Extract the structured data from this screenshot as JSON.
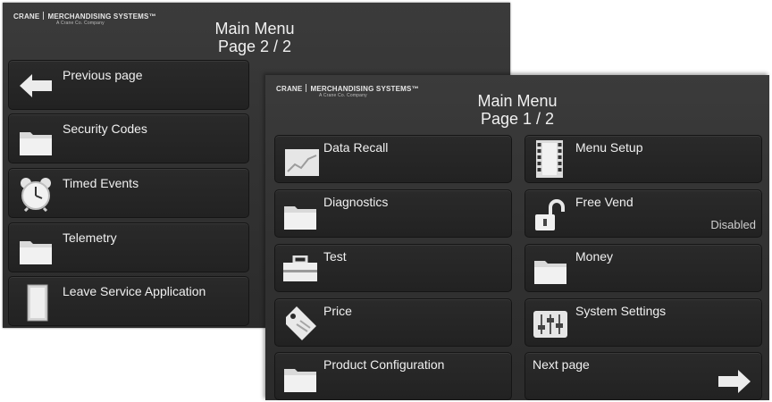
{
  "brand": {
    "name_left": "CRANE",
    "name_right": "MERCHANDISING SYSTEMS",
    "trademark": "™",
    "tagline": "A Crane Co. Company"
  },
  "screens": [
    {
      "title": "Main Menu",
      "page": "Page 2 / 2",
      "buttons": [
        {
          "label": "Previous page",
          "icon": "left-arrow-icon"
        },
        {
          "label": "Security Codes",
          "icon": "folder-icon"
        },
        {
          "label": "Timed Events",
          "icon": "alarm-clock-icon"
        },
        {
          "label": "Telemetry",
          "icon": "folder-icon"
        },
        {
          "label": "Leave Service Application",
          "icon": "door-icon"
        }
      ]
    },
    {
      "title": "Main Menu",
      "page": "Page 1 / 2",
      "buttons": [
        {
          "label": "Data Recall",
          "icon": "chart-icon"
        },
        {
          "label": "Menu Setup",
          "icon": "film-strip-icon"
        },
        {
          "label": "Diagnostics",
          "icon": "folder-icon"
        },
        {
          "label": "Free Vend",
          "icon": "unlocked-padlock-icon",
          "status": "Disabled"
        },
        {
          "label": "Test",
          "icon": "toolbox-icon"
        },
        {
          "label": "Money",
          "icon": "folder-icon"
        },
        {
          "label": "Price",
          "icon": "price-tag-icon"
        },
        {
          "label": "System Settings",
          "icon": "sliders-icon"
        },
        {
          "label": "Product Configuration",
          "icon": "folder-icon"
        },
        {
          "label": "Next page",
          "icon": "right-arrow-icon"
        }
      ]
    }
  ]
}
